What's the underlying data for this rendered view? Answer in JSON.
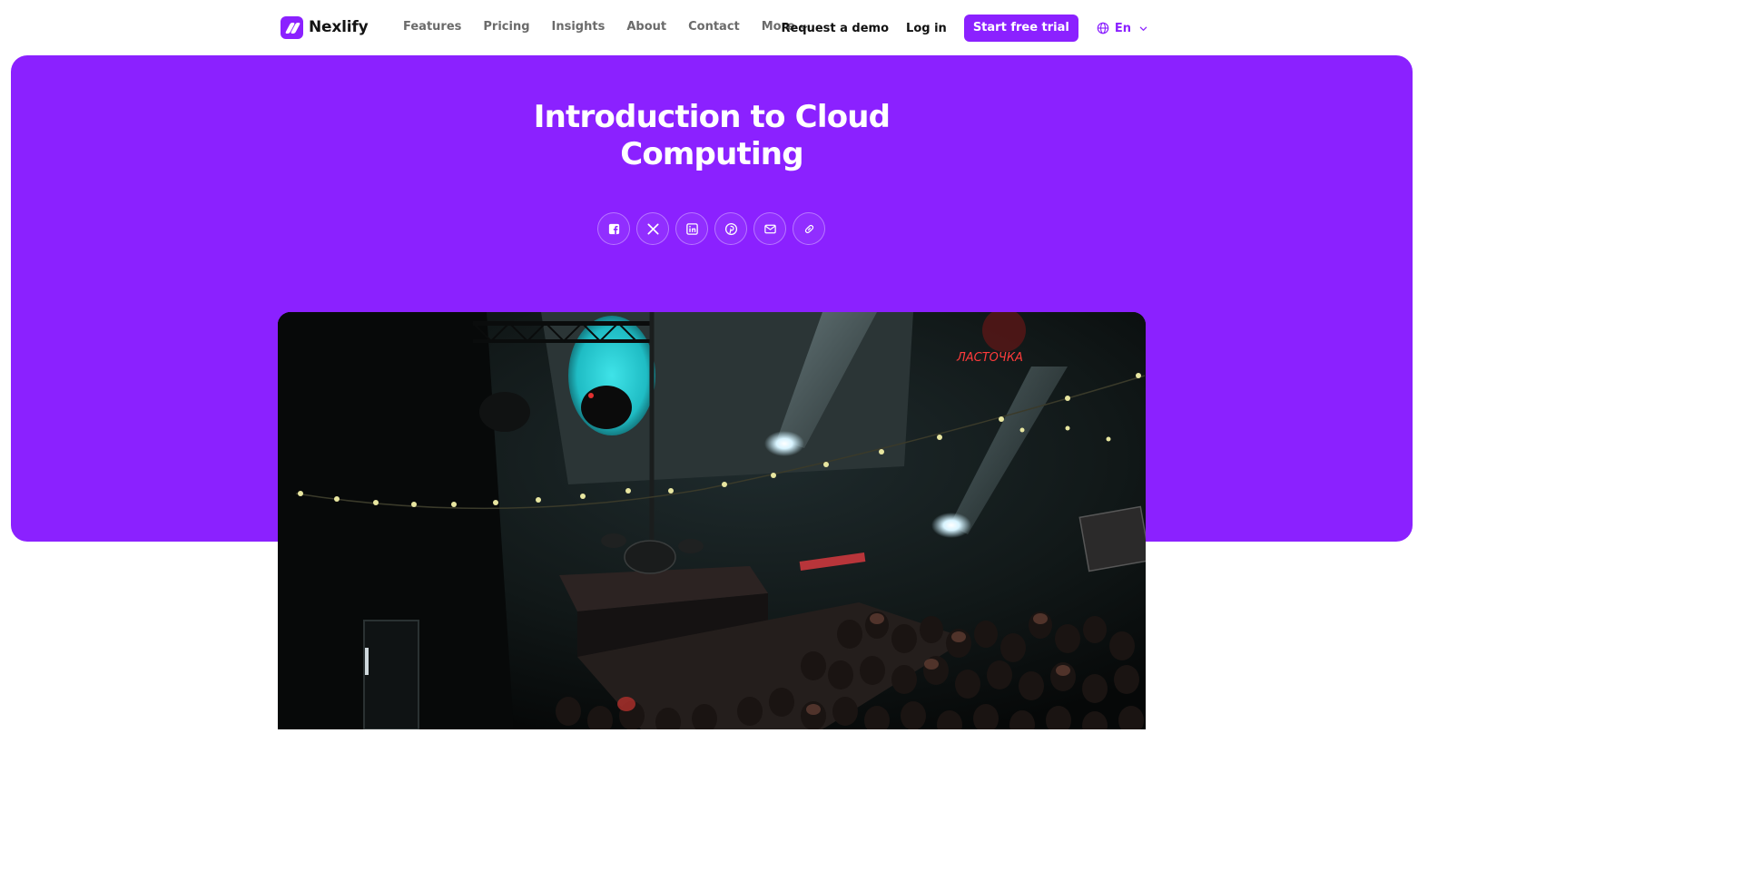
{
  "brand": {
    "name": "Nexlify"
  },
  "nav": {
    "items": [
      {
        "label": "Features"
      },
      {
        "label": "Pricing"
      },
      {
        "label": "Insights"
      },
      {
        "label": "About"
      },
      {
        "label": "Contact"
      },
      {
        "label": "More"
      }
    ],
    "request_demo": "Request a demo",
    "login": "Log in",
    "cta": "Start free trial",
    "language": "En"
  },
  "hero": {
    "title_line1": "Introduction to Cloud",
    "title_line2": "Computing",
    "share_icons": [
      "facebook-icon",
      "x-icon",
      "linkedin-icon",
      "pinterest-icon",
      "email-icon",
      "link-icon"
    ]
  },
  "photo": {
    "sign_text": "ЛАСТОЧКА"
  },
  "colors": {
    "accent": "#8b21ff",
    "text_muted": "#6b6b6b",
    "text_dark": "#111111"
  }
}
